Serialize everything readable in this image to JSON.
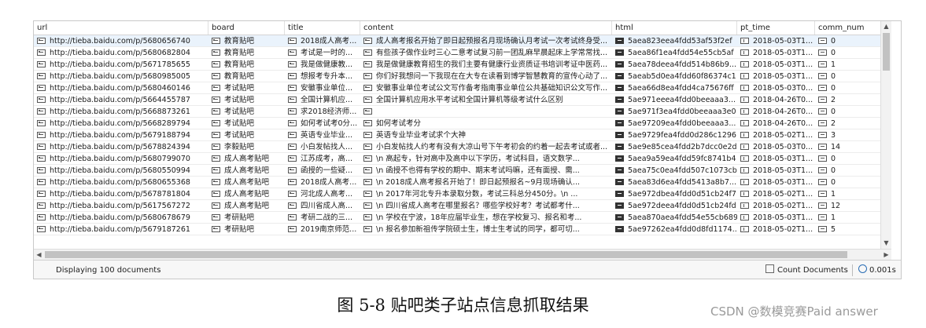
{
  "columns": [
    {
      "key": "url",
      "label": "url"
    },
    {
      "key": "board",
      "label": "board"
    },
    {
      "key": "title",
      "label": "title"
    },
    {
      "key": "content",
      "label": "content"
    },
    {
      "key": "html",
      "label": "html"
    },
    {
      "key": "pt_time",
      "label": "pt_time"
    },
    {
      "key": "comm_num",
      "label": "comm_num"
    }
  ],
  "rows": [
    {
      "url": "http://tieba.baidu.com/p/5680656740",
      "board": "教育贴吧",
      "title": "2018成人高考...",
      "content": "成人高考报名开始了即日起预报名月现场确认月考试一次考试终身受...",
      "html": "5aea823eea4fdd53af53f2ef",
      "pt_time": "2018-05-03T1...",
      "comm_num": "0"
    },
    {
      "url": "http://tieba.baidu.com/p/5680682804",
      "board": "教育贴吧",
      "title": "考试是一时的...",
      "content": "有些孩子做作业时三心二意考试复习前一团乱麻早晨起床上学常常找...",
      "html": "5aea86f1ea4fdd54e55cb5af",
      "pt_time": "2018-05-03T1...",
      "comm_num": "0"
    },
    {
      "url": "http://tieba.baidu.com/p/5671785655",
      "board": "教育贴吧",
      "title": "我是做健康教...",
      "content": "我是做健康教育招生的我们主要有健康行业资质证书培训考证中医药...",
      "html": "5aea78deea4fdd514b86b9...",
      "pt_time": "2018-05-03T1...",
      "comm_num": "1"
    },
    {
      "url": "http://tieba.baidu.com/p/5680985005",
      "board": "教育贴吧",
      "title": "想报考专升本...",
      "content": "你们好我想问一下我现在在大专在读看到博学智慧教育的宣传心动了...",
      "html": "5aeab5d0ea4fdd60f86374c1",
      "pt_time": "2018-05-03T1...",
      "comm_num": "0"
    },
    {
      "url": "http://tieba.baidu.com/p/5680460146",
      "board": "考试贴吧",
      "title": "安徽事业单位...",
      "content": "安徽事业单位考试公文写作备考指南事业单位公共基础知识公文写作...",
      "html": "5aea66d8ea4fdd4ca75676ff",
      "pt_time": "2018-05-03T0...",
      "comm_num": "0"
    },
    {
      "url": "http://tieba.baidu.com/p/5664455787",
      "board": "考试贴吧",
      "title": "全国计算机应...",
      "content": "全国计算机应用水平考试和全国计算机等级考试什么区别",
      "html": "5ae971eeea4fdd0beeaaa3...",
      "pt_time": "2018-04-26T0...",
      "comm_num": "2"
    },
    {
      "url": "http://tieba.baidu.com/p/5668873261",
      "board": "考试贴吧",
      "title": "求2018经济师...",
      "content": "",
      "html": "5ae971f3ea4fdd0beeaaa3e0",
      "pt_time": "2018-04-26T0...",
      "comm_num": "0"
    },
    {
      "url": "http://tieba.baidu.com/p/5668289794",
      "board": "考试贴吧",
      "title": "如何考试考0分...",
      "content": "如何考试考分",
      "html": "5ae97209ea4fdd0beeaaa3...",
      "pt_time": "2018-04-26T0...",
      "comm_num": "2"
    },
    {
      "url": "http://tieba.baidu.com/p/5679188794",
      "board": "考试贴吧",
      "title": "英语专业毕业...",
      "content": "英语专业毕业考试求个大神",
      "html": "5ae9729fea4fdd0d286c1296",
      "pt_time": "2018-05-02T1...",
      "comm_num": "3"
    },
    {
      "url": "http://tieba.baidu.com/p/5678824394",
      "board": "李毅贴吧",
      "title": "小白发帖找人...",
      "content": "小白发帖找人约考有没有大凉山号下午考初会的约着一起去考试或者...",
      "html": "5ae9e85cea4fdd2b7dcc0e2d",
      "pt_time": "2018-05-03T0...",
      "comm_num": "14"
    },
    {
      "url": "http://tieba.baidu.com/p/5680799070",
      "board": "成人高考贴吧",
      "title": "江苏成考，高...",
      "content": "\\n             高起专，针对高中及高中以下学历，考试科目，语文数学...",
      "html": "5aea9a59ea4fdd59fc8741b4",
      "pt_time": "2018-05-03T1...",
      "comm_num": "0"
    },
    {
      "url": "http://tieba.baidu.com/p/5680550994",
      "board": "成人高考贴吧",
      "title": "函授的一些疑...",
      "content": "\\n             函授不也得有学校的期中、期末考试吗嘛，还有面授、需...",
      "html": "5aea75c0ea4fdd507c1073cb",
      "pt_time": "2018-05-03T1...",
      "comm_num": "0"
    },
    {
      "url": "http://tieba.baidu.com/p/5680655368",
      "board": "成人高考贴吧",
      "title": "2018成人高考...",
      "content": "\\n             2018成人高考报名开始了！即日起预报名~9月现场确认...",
      "html": "5aea83d6ea4fdd5413a8b7...",
      "pt_time": "2018-05-03T1...",
      "comm_num": "0"
    },
    {
      "url": "http://tieba.baidu.com/p/5678781804",
      "board": "成人高考贴吧",
      "title": "河北成人高考...",
      "content": "\\n             2017年河北专升本录取分数，考试三科总分450分。\\n ...",
      "html": "5ae972dbea4fdd0d51cb24f7",
      "pt_time": "2018-05-02T1...",
      "comm_num": "1"
    },
    {
      "url": "http://tieba.baidu.com/p/5617567272",
      "board": "成人高考贴吧",
      "title": "四川省成人高...",
      "content": "\\n             四川省成人高考在哪里报名？哪些学校好考？考试都考什...",
      "html": "5ae972deea4fdd0d51cb24fd",
      "pt_time": "2018-05-02T1...",
      "comm_num": "12"
    },
    {
      "url": "http://tieba.baidu.com/p/5680678679",
      "board": "考研贴吧",
      "title": "考研二战的三...",
      "content": "\\n             学校在宁波，18年应届毕业生，想在学校复习、报名和考...",
      "html": "5aea870aea4fdd54e55cb689",
      "pt_time": "2018-05-03T1...",
      "comm_num": "1"
    },
    {
      "url": "http://tieba.baidu.com/p/5679187261",
      "board": "考研贴吧",
      "title": "2019南京师范...",
      "content": "\\n             报名参加新祖传学院硕士生，博士生考试的同学，都可切...",
      "html": "5ae97262ea4fdd0d8fd1174...",
      "pt_time": "2018-05-02T1...",
      "comm_num": "5"
    }
  ],
  "status": {
    "displaying": "Displaying 100 documents",
    "count_label": "Count Documents",
    "timing": "0.001s"
  },
  "caption": "图 5-8  贴吧类子站点信息抓取结果",
  "watermark": "CSDN @数模竞赛Paid answer"
}
